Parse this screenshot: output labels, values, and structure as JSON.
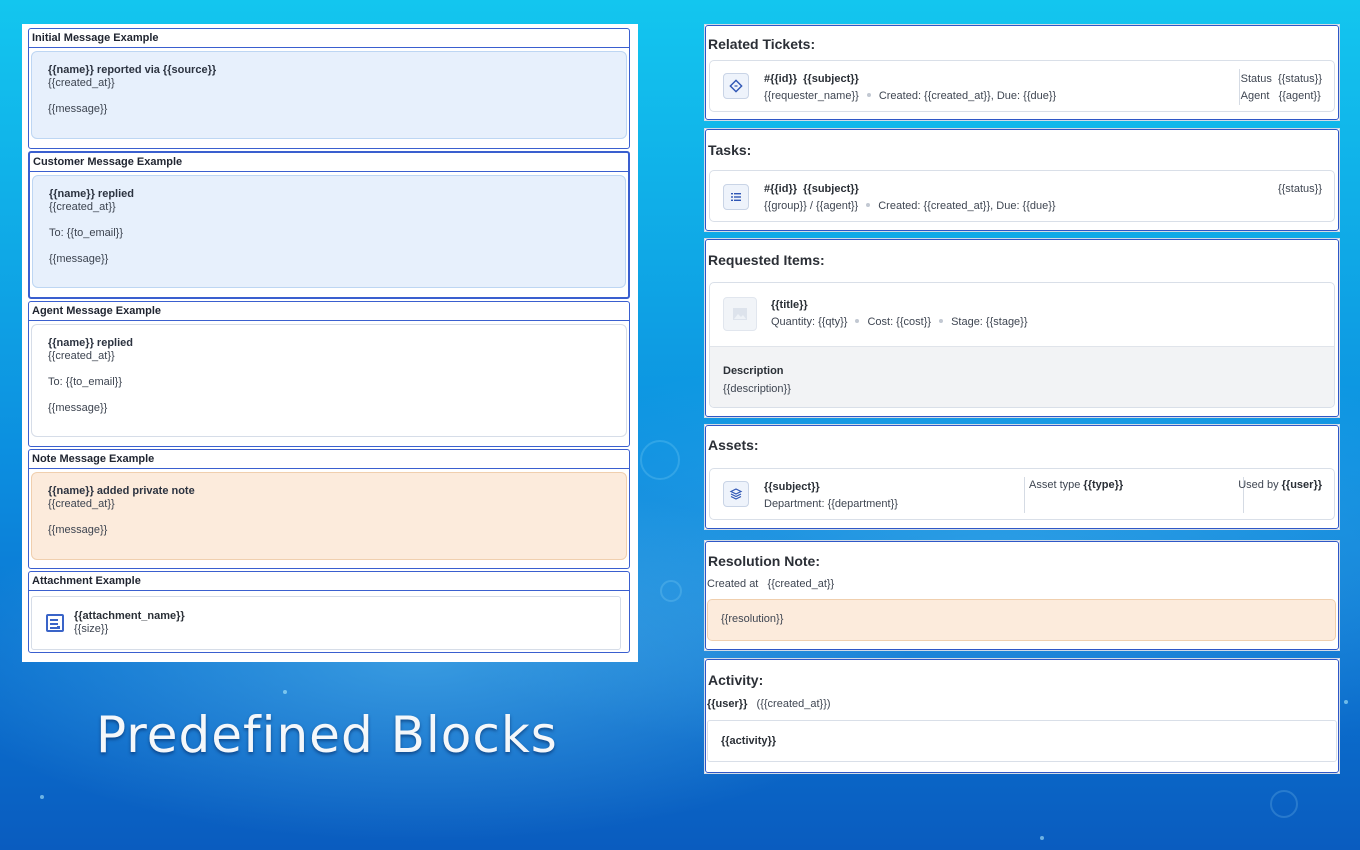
{
  "left_blocks": {
    "initial": {
      "title": "Initial Message Example",
      "head": "{{name}} reported via {{source}}",
      "created": "{{created_at}}",
      "message": "{{message}}"
    },
    "customer": {
      "title": "Customer Message Example",
      "head": "{{name}} replied",
      "created": "{{created_at}}",
      "to": "To: {{to_email}}",
      "message": "{{message}}"
    },
    "agent": {
      "title": "Agent Message Example",
      "head": "{{name}} replied",
      "created": "{{created_at}}",
      "to": "To: {{to_email}}",
      "message": "{{message}}"
    },
    "note": {
      "title": "Note Message Example",
      "head": "{{name}} added private note",
      "created": "{{created_at}}",
      "message": "{{message}}"
    },
    "attachment": {
      "title": "Attachment Example",
      "name": "{{attachment_name}}",
      "size": "{{size}}",
      "icon": "document-icon"
    }
  },
  "related_tickets": {
    "title": "Related Tickets:",
    "id": "#{{id}}",
    "subject": "{{subject}}",
    "requester": "{{requester_name}}",
    "dates": "Created: {{created_at}}, Due: {{due}}",
    "status_label": "Status",
    "status_value": "{{status}}",
    "agent_label": "Agent",
    "agent_value": "{{agent}}",
    "icon": "ticket-icon"
  },
  "tasks": {
    "title": "Tasks:",
    "id": "#{{id}}",
    "subject": "{{subject}}",
    "group_agent": "{{group}} / {{agent}}",
    "dates": "Created: {{created_at}}, Due: {{due}}",
    "status": "{{status}}",
    "icon": "list-icon"
  },
  "requested_items": {
    "title": "Requested Items:",
    "item_title": "{{title}}",
    "qty": "Quantity: {{qty}}",
    "cost": "Cost: {{cost}}",
    "stage": "Stage: {{stage}}",
    "desc_label": "Description",
    "desc_value": "{{description}}",
    "icon": "image-icon"
  },
  "assets": {
    "title": "Assets:",
    "subject": "{{subject}}",
    "department": "Department: {{department}}",
    "type_label": "Asset type",
    "type_value": "{{type}}",
    "used_label": "Used by",
    "used_value": "{{user}}",
    "icon": "layers-icon"
  },
  "resolution": {
    "title": "Resolution Note:",
    "created_label": "Created at",
    "created_value": "{{created_at}}",
    "text": "{{resolution}}"
  },
  "activity": {
    "title": "Activity:",
    "user": "{{user}}",
    "created": "({{created_at}})",
    "text": "{{activity}}"
  },
  "slide_title": "Predefined Blocks"
}
